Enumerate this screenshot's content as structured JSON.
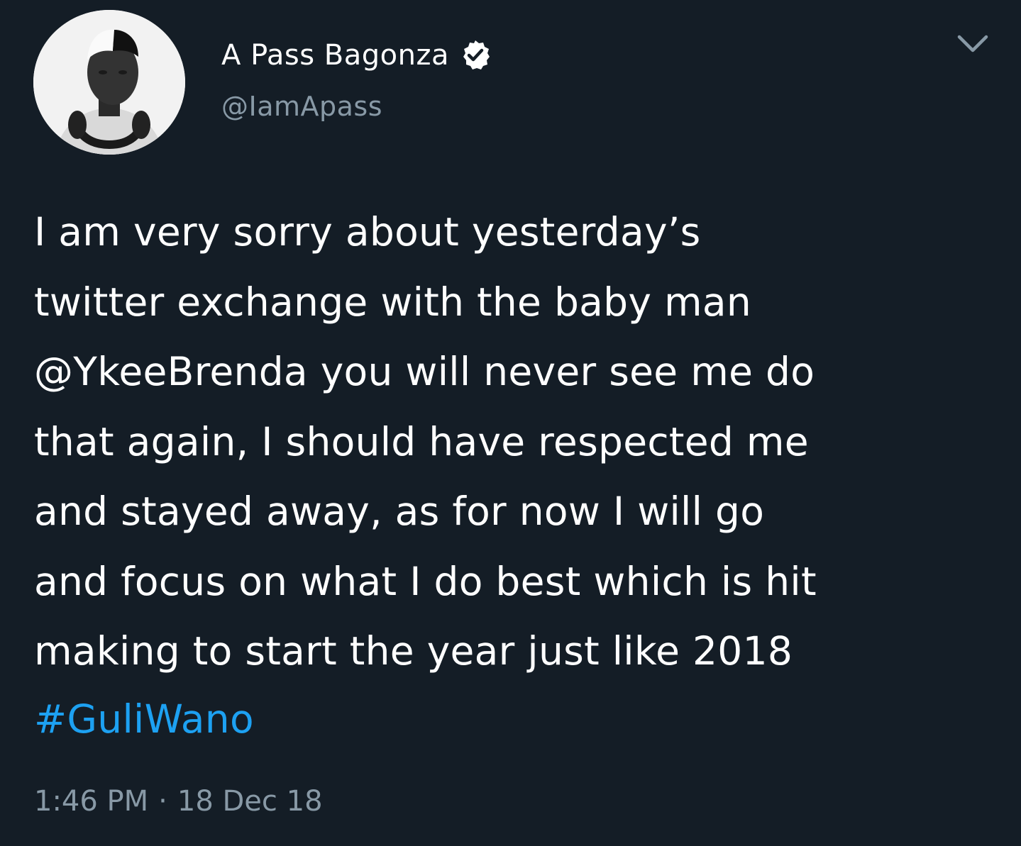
{
  "author": {
    "display_name": "A Pass Bagonza",
    "handle": "@IamApass",
    "verified": true
  },
  "tweet": {
    "text": "I am very sorry about yesterday’s\ntwitter exchange with the baby man\n@YkeeBrenda you will never see me do\nthat again, I should have respected me\nand stayed away, as for now I will go\nand focus on what I do best which is hit\nmaking to start the year just like 2018",
    "hashtag": "#GuliWano",
    "time": "1:46 PM",
    "separator": "·",
    "date": "18 Dec 18"
  },
  "icons": {
    "menu": "chevron-down-icon",
    "verified": "verified-badge-icon"
  },
  "colors": {
    "background": "#141d26",
    "text": "#ffffff",
    "secondary_text": "#8899a6",
    "link": "#1da1f2",
    "verified_badge": "#ffffff"
  }
}
